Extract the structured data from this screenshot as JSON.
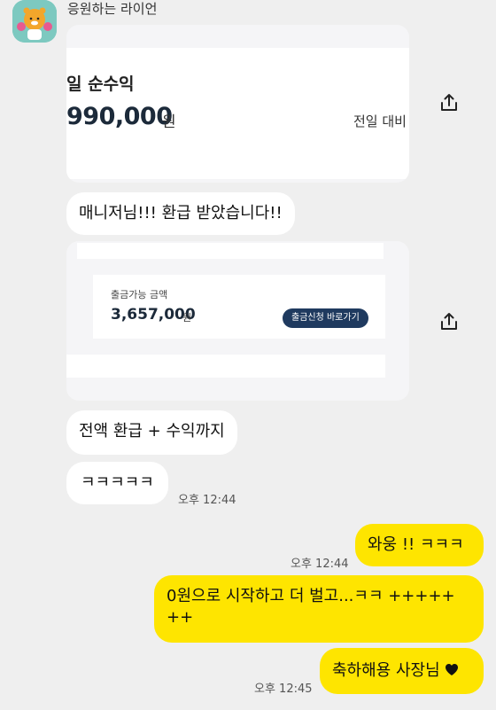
{
  "sender": {
    "name": "응원하는 라이언"
  },
  "card1": {
    "title_fragment": "일 순수익",
    "amount": "990,000",
    "currency": "원",
    "compare_label": "전일 대비"
  },
  "card2": {
    "label": "출금가능 금액",
    "amount": "3,657,000",
    "currency": "원",
    "button_label": "출금신청 바로가기"
  },
  "messages": [
    {
      "id": "m1",
      "text": "매니저님!!! 환급 받았습니다!!"
    },
    {
      "id": "m2",
      "text": "전액 환급 + 수익까지"
    },
    {
      "id": "m3",
      "text": "ㅋㅋㅋㅋㅋ",
      "time": "오후 12:44"
    },
    {
      "id": "m4",
      "text": "와웅 !! ㅋㅋㅋ",
      "time": "오후 12:44"
    },
    {
      "id": "m5",
      "text_line1": "0원으로 시작하고 더 벌고...ㅋㅋ +++++",
      "text_line2": "++"
    },
    {
      "id": "m6",
      "text": "축하해용 사장님",
      "time": "오후 12:45"
    }
  ],
  "colors": {
    "background": "#efefef",
    "my_bubble": "#fee500",
    "their_bubble": "#ffffff",
    "button_navy": "#1f3a5f"
  },
  "icons": {
    "share": "share-icon",
    "heart": "heart-icon"
  }
}
